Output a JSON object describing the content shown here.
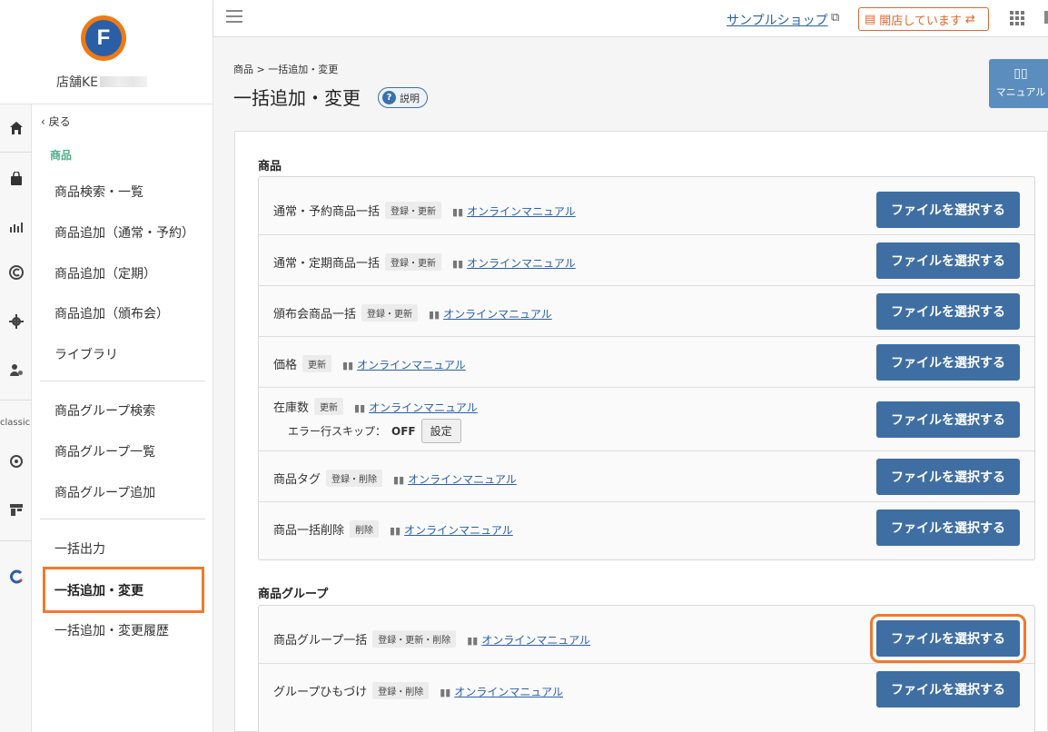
{
  "brand": {
    "logo_letter": "F",
    "store_name": "店舗KE"
  },
  "topbar": {
    "shop_link": "サンプルショップ",
    "open_status": "開店しています"
  },
  "rail": {
    "classic_label": "classic"
  },
  "submenu": {
    "back": "戻る",
    "section": "商品",
    "items": [
      "商品検索・一覧",
      "商品追加（通常・予約）",
      "商品追加（定期）",
      "商品追加（頒布会）",
      "ライブラリ",
      "商品グループ検索",
      "商品グループ一覧",
      "商品グループ追加",
      "一括出力",
      "一括追加・変更",
      "一括追加・変更履歴"
    ]
  },
  "page": {
    "breadcrumb": "商品 > 一括追加・変更",
    "title": "一括追加・変更",
    "help": "説明",
    "manual": "マニュアル"
  },
  "groups": [
    {
      "title": "商品",
      "rows": [
        {
          "name": "通常・予約商品一括",
          "tag": "登録・更新",
          "link": "オンラインマニュアル",
          "button": "ファイルを選択する"
        },
        {
          "name": "通常・定期商品一括",
          "tag": "登録・更新",
          "link": "オンラインマニュアル",
          "button": "ファイルを選択する"
        },
        {
          "name": "頒布会商品一括",
          "tag": "登録・更新",
          "link": "オンラインマニュアル",
          "button": "ファイルを選択する"
        },
        {
          "name": "価格",
          "tag": "更新",
          "link": "オンラインマニュアル",
          "button": "ファイルを選択する"
        },
        {
          "name": "在庫数",
          "tag": "更新",
          "link": "オンラインマニュアル",
          "button": "ファイルを選択する",
          "skip_label": "エラー行スキップ：",
          "skip_value": "OFF",
          "settings": "設定"
        },
        {
          "name": "商品タグ",
          "tag": "登録・削除",
          "link": "オンラインマニュアル",
          "button": "ファイルを選択する"
        },
        {
          "name": "商品一括削除",
          "tag": "削除",
          "link": "オンラインマニュアル",
          "button": "ファイルを選択する"
        }
      ]
    },
    {
      "title": "商品グループ",
      "rows": [
        {
          "name": "商品グループ一括",
          "tag": "登録・更新・削除",
          "link": "オンラインマニュアル",
          "button": "ファイルを選択する"
        },
        {
          "name": "グループひもづけ",
          "tag": "登録・削除",
          "link": "オンラインマニュアル",
          "button": "ファイルを選択する"
        }
      ]
    }
  ],
  "colors": {
    "accent_orange": "#f07a2c",
    "button_blue": "#3f6ea3",
    "link_blue": "#2a5fa8",
    "section_green": "#4fae8c"
  },
  "icons": [
    "home-icon",
    "shopping-bag-icon",
    "chart-icon",
    "c-circle-icon",
    "gear-icon",
    "user-gear-icon",
    "cycle-icon",
    "store-icon",
    "c-logo-icon",
    "book-icon",
    "external-link-icon",
    "swap-icon",
    "grid-icon",
    "hamburger-icon",
    "question-icon"
  ]
}
